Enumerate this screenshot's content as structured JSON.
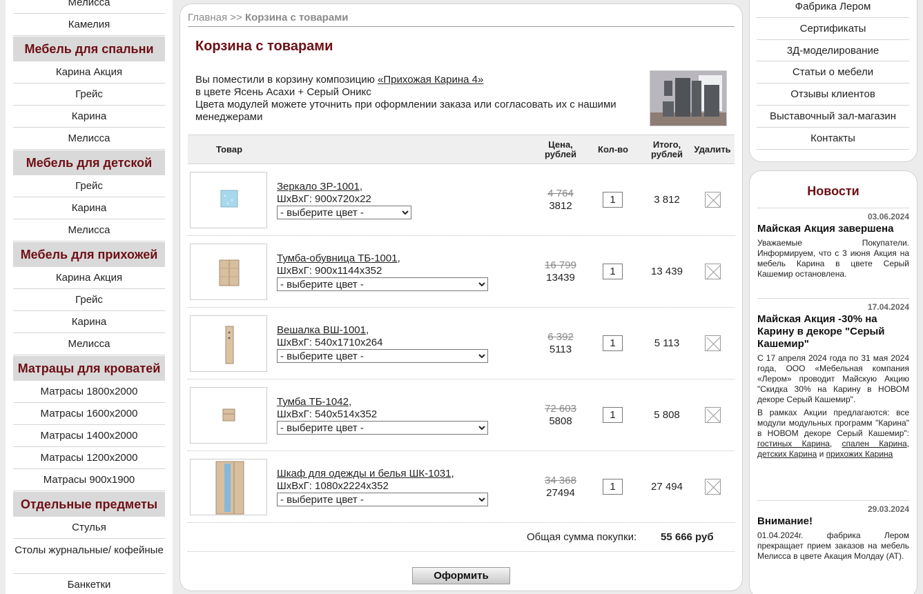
{
  "left_menu": [
    {
      "type": "link",
      "label": "Мелисса"
    },
    {
      "type": "link",
      "label": "Камелия"
    },
    {
      "type": "cat",
      "label": "Мебель для спальни"
    },
    {
      "type": "link",
      "label": "Карина Акция"
    },
    {
      "type": "link",
      "label": "Грейс"
    },
    {
      "type": "link",
      "label": "Карина"
    },
    {
      "type": "link",
      "label": "Мелисса"
    },
    {
      "type": "cat",
      "label": "Мебель для детской"
    },
    {
      "type": "link",
      "label": "Грейс"
    },
    {
      "type": "link",
      "label": "Карина"
    },
    {
      "type": "link",
      "label": "Мелисса"
    },
    {
      "type": "cat",
      "label": "Мебель для прихожей"
    },
    {
      "type": "link",
      "label": "Карина Акция"
    },
    {
      "type": "link",
      "label": "Грейс"
    },
    {
      "type": "link",
      "label": "Карина"
    },
    {
      "type": "link",
      "label": "Мелисса"
    },
    {
      "type": "cat",
      "label": "Матрацы для кроватей"
    },
    {
      "type": "link",
      "label": "Матрасы 1800x2000"
    },
    {
      "type": "link",
      "label": "Матрасы 1600x2000"
    },
    {
      "type": "link",
      "label": "Матрасы 1400x2000"
    },
    {
      "type": "link",
      "label": "Матрасы 1200x2000"
    },
    {
      "type": "link",
      "label": "Матрасы 900x1900"
    },
    {
      "type": "cat",
      "label": "Отдельные предметы"
    },
    {
      "type": "link",
      "label": "Стулья"
    },
    {
      "type": "link",
      "label": "Столы журнальные/ кофейные",
      "tall": true
    },
    {
      "type": "link",
      "label": "Банкетки"
    }
  ],
  "breadcrumb": {
    "home": "Главная",
    "sep": ">>",
    "current": "Корзина с товарами"
  },
  "page_title": "Корзина с товарами",
  "intro": {
    "line1_prefix": "Вы поместили в корзину композицию ",
    "link": "«Прихожая Карина 4»",
    "line2": "в цвете Ясень Асахи + Серый Оникс",
    "line3": "Цвета модулей можете уточнить при оформлении заказа или согласовать их с нашими менеджерами"
  },
  "table_headers": {
    "product": "Товар",
    "price": "Цена, рублей",
    "qty": "Кол-во",
    "total": "Итого, рублей",
    "delete": "Удалить"
  },
  "items": [
    {
      "name": "Зеркало ЗР-1001",
      "dims": "ШхВхГ: 900х720х22",
      "select": "- выберите цвет -",
      "old_price": "4 764",
      "price": "3812",
      "qty": "1",
      "total": "3 812",
      "img": "mirror"
    },
    {
      "name": "Тумба-обувница ТБ-1001",
      "dims": "ШхВхГ: 900х1144х352",
      "select": "- выберите цвет -",
      "old_price": "16 799",
      "price": "13439",
      "qty": "1",
      "total": "13 439",
      "img": "cabinet"
    },
    {
      "name": "Вешалка ВШ-1001",
      "dims": "ШхВхГ: 540х1710х264",
      "select": "- выберите цвет -",
      "old_price": "6 392",
      "price": "5113",
      "qty": "1",
      "total": "5 113",
      "img": "hanger"
    },
    {
      "name": "Тумба ТБ-1042",
      "dims": "ШхВхГ: 540х514х352",
      "select": "- выберите цвет -",
      "old_price": "72 603",
      "price": "5808",
      "qty": "1",
      "total": "5 808",
      "img": "small-cabinet"
    },
    {
      "name": "Шкаф для одежды и белья ШК-1031",
      "dims": "ШхВхГ: 1080х2224х352",
      "select": "- выберите цвет -",
      "old_price": "34 368",
      "price": "27494",
      "qty": "1",
      "total": "27 494",
      "img": "wardrobe"
    }
  ],
  "sum": {
    "label": "Общая сумма покупки:",
    "value": "55 666 руб"
  },
  "order_button": "Оформить",
  "right_menu": [
    "Фабрика Лером",
    "Сертификаты",
    "3Д-моделирование",
    "Статьи о мебели",
    "Отзывы клиентов",
    "Выставочный зал-магазин",
    "Контакты"
  ],
  "news": {
    "title": "Новости",
    "items": [
      {
        "date": "03.06.2024",
        "head": "Майская Акция завершена",
        "text": "Уважаемые Покупатели. Информируем, что с 3 июня Акция на мебель Карина в цвете Серый Кашемир остановлена."
      },
      {
        "date": "17.04.2024",
        "head": "Майская Акция -30% на Карину в декоре \"Серый Кашемир\"",
        "text": "С 17 апреля 2024 года по 31 мая 2024 года, ООО «Мебельная компания «Лером» проводит Майскую Акцию \"Скидка 30% на Карину в НОВОМ декоре Серый Кашемир\".",
        "text2_prefix": "В рамках Акции предлагаются: все модули модульных программ \"Карина\" в НОВОМ декоре Серый Кашемир\": ",
        "links": [
          "гостиных Карина",
          "спален Карина",
          "детских Карина",
          "прихожих Карина"
        ]
      },
      {
        "date": "29.03.2024",
        "head": "Внимание!",
        "text": "01.04.2024г. фабрика Лером прекращает прием заказов на мебель Мелисса в цвете Акация Молдау (АТ)."
      }
    ]
  },
  "colors": {
    "accent": "#6e0f16",
    "category_bg": "#d9d9d9",
    "page_bg": "#ececec"
  }
}
